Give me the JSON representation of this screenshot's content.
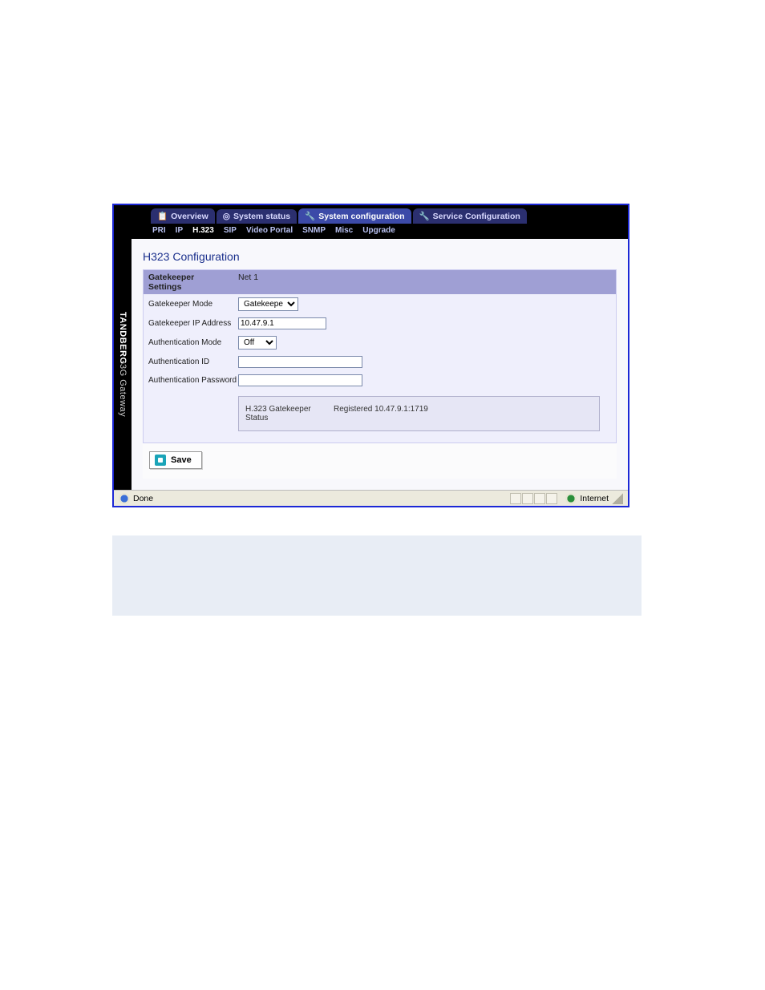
{
  "tabs": {
    "overview": "Overview",
    "system_status": "System status",
    "system_configuration": "System configuration",
    "service_configuration": "Service Configuration"
  },
  "subtabs": {
    "pri": "PRI",
    "ip": "IP",
    "h323": "H.323",
    "sip": "SIP",
    "video_portal": "Video Portal",
    "snmp": "SNMP",
    "misc": "Misc",
    "upgrade": "Upgrade"
  },
  "sidebar": {
    "brand": "TANDBERG",
    "product": "3G Gateway"
  },
  "page": {
    "title": "H323 Configuration"
  },
  "panel": {
    "section_label": "Gatekeeper Settings",
    "net_label": "Net 1"
  },
  "form": {
    "gatekeeper_mode_label": "Gatekeeper Mode",
    "gatekeeper_mode_value": "Gatekeeper",
    "gatekeeper_ip_label": "Gatekeeper IP Address",
    "gatekeeper_ip_value": "10.47.9.1",
    "auth_mode_label": "Authentication Mode",
    "auth_mode_value": "Off",
    "auth_id_label": "Authentication ID",
    "auth_id_value": "",
    "auth_pw_label": "Authentication Password",
    "auth_pw_value": ""
  },
  "status": {
    "label": "H.323 Gatekeeper Status",
    "value": "Registered 10.47.9.1:1719"
  },
  "buttons": {
    "save": "Save"
  },
  "statusbar": {
    "done": "Done",
    "zone": "Internet"
  }
}
